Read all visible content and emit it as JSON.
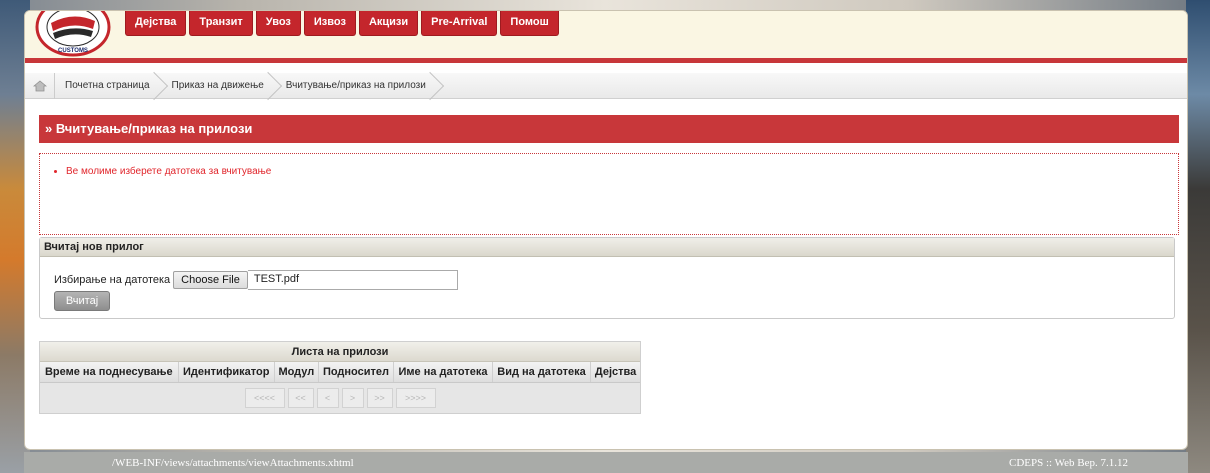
{
  "header": {
    "logo_text": "ЦАРИНА • CUSTOMS",
    "nav": [
      "Дејства",
      "Транзит",
      "Увоз",
      "Извоз",
      "Акцизи",
      "Pre-Arrival",
      "Помош"
    ]
  },
  "breadcrumb": [
    "Почетна страница",
    "Приказ на движење",
    "Вчитување/приказ на прилози"
  ],
  "page": {
    "title": "» Вчитување/приказ на прилози",
    "message": "Ве молиме изберете датотека за вчитување"
  },
  "upload": {
    "panel_title": "Вчитај нов прилог",
    "file_label": "Избирање на датотека",
    "choose_label": "Choose File",
    "file_name": "TEST.pdf",
    "upload_label": "Вчитај"
  },
  "attachments": {
    "caption": "Листа на прилози",
    "columns": [
      "Време на поднесување",
      "Идентификатор",
      "Модул",
      "Подносител",
      "Име на датотека",
      "Вид на датотека",
      "Дејства"
    ],
    "pager": [
      "<<<<",
      "<<",
      "<",
      ">",
      ">>",
      ">>>>"
    ]
  },
  "footer": {
    "path": "/WEB-INF/views/attachments/viewAttachments.xhtml",
    "version": "CDEPS :: Web Вер. 7.1.12"
  },
  "colors": {
    "brand_red": "#c8373a",
    "nav_red": "#c4262c",
    "message_red": "#e1262c",
    "header_bg": "#faf6e3"
  }
}
